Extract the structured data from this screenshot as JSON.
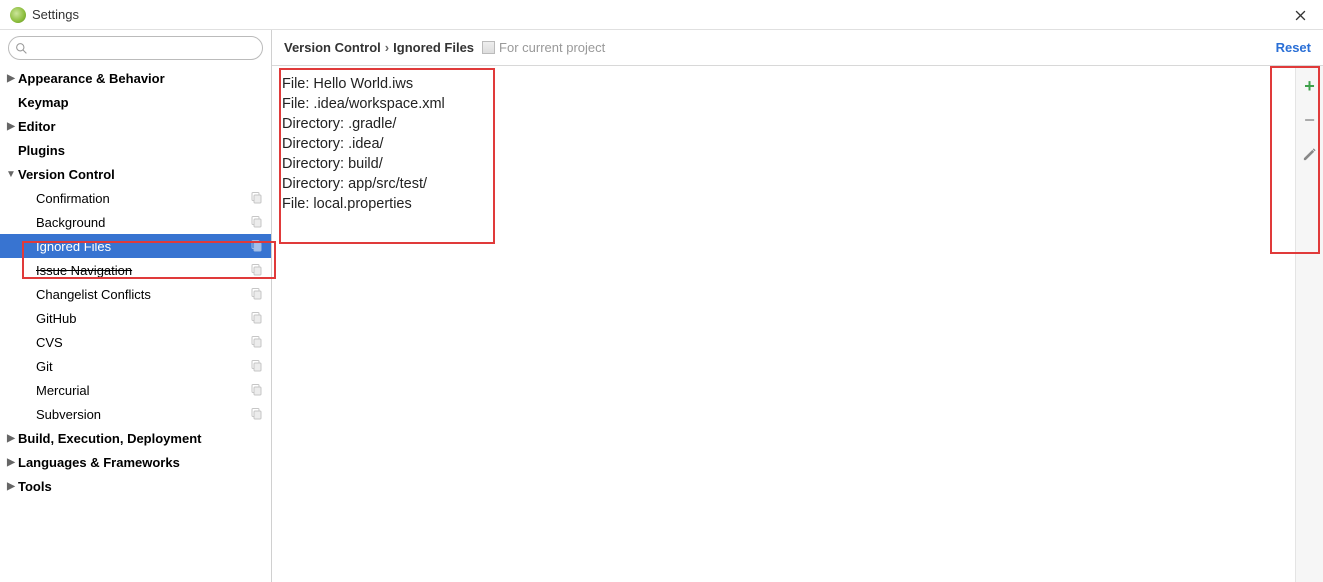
{
  "window": {
    "title": "Settings"
  },
  "search": {
    "placeholder": ""
  },
  "sidebar": {
    "items": [
      {
        "label": "Appearance & Behavior",
        "level": 0,
        "arrow": "right",
        "bold": true,
        "copy": false
      },
      {
        "label": "Keymap",
        "level": 0,
        "arrow": "none",
        "bold": true,
        "copy": false
      },
      {
        "label": "Editor",
        "level": 0,
        "arrow": "right",
        "bold": true,
        "copy": false
      },
      {
        "label": "Plugins",
        "level": 0,
        "arrow": "none",
        "bold": true,
        "copy": false
      },
      {
        "label": "Version Control",
        "level": 0,
        "arrow": "down",
        "bold": true,
        "copy": false
      },
      {
        "label": "Confirmation",
        "level": 1,
        "arrow": "none",
        "bold": false,
        "copy": true
      },
      {
        "label": "Background",
        "level": 1,
        "arrow": "none",
        "bold": false,
        "copy": true
      },
      {
        "label": "Ignored Files",
        "level": 1,
        "arrow": "none",
        "bold": false,
        "copy": true,
        "selected": true
      },
      {
        "label": "Issue Navigation",
        "level": 1,
        "arrow": "none",
        "bold": false,
        "copy": true,
        "strike": true
      },
      {
        "label": "Changelist Conflicts",
        "level": 1,
        "arrow": "none",
        "bold": false,
        "copy": true
      },
      {
        "label": "GitHub",
        "level": 1,
        "arrow": "none",
        "bold": false,
        "copy": true
      },
      {
        "label": "CVS",
        "level": 1,
        "arrow": "none",
        "bold": false,
        "copy": true
      },
      {
        "label": "Git",
        "level": 1,
        "arrow": "none",
        "bold": false,
        "copy": true
      },
      {
        "label": "Mercurial",
        "level": 1,
        "arrow": "none",
        "bold": false,
        "copy": true
      },
      {
        "label": "Subversion",
        "level": 1,
        "arrow": "none",
        "bold": false,
        "copy": true
      },
      {
        "label": "Build, Execution, Deployment",
        "level": 0,
        "arrow": "right",
        "bold": true,
        "copy": false
      },
      {
        "label": "Languages & Frameworks",
        "level": 0,
        "arrow": "right",
        "bold": true,
        "copy": false
      },
      {
        "label": "Tools",
        "level": 0,
        "arrow": "right",
        "bold": true,
        "copy": false
      }
    ]
  },
  "breadcrumb": {
    "parent": "Version Control",
    "separator": "›",
    "current": "Ignored Files",
    "scope": "For current project",
    "reset_label": "Reset"
  },
  "ignored_files": [
    "File: Hello World.iws",
    "File: .idea/workspace.xml",
    "Directory: .gradle/",
    "Directory: .idea/",
    "Directory: build/",
    "Directory: app/src/test/",
    "File: local.properties"
  ],
  "toolbar": {
    "add": "+",
    "remove": "−"
  }
}
